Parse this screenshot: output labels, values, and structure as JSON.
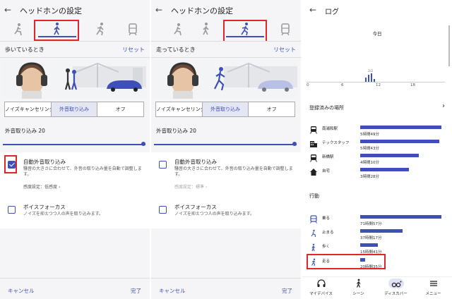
{
  "panel1": {
    "title": "ヘッドホンの設定",
    "section_label": "歩いているとき",
    "reset": "リセット",
    "modes": [
      "ノイズキャンセリング",
      "外音取り込み",
      "オフ"
    ],
    "selected_mode_index": 1,
    "ambient_label": "外音取り込み 20",
    "ambient_slider_fraction": 1.0,
    "auto_ambient_title": "自動外音取り込み",
    "auto_ambient_desc": "騒音の大きさに合わせて、外音の取り込み量を自動で調整します。",
    "auto_ambient_checked": true,
    "sensitivity": "感度設定：低感度",
    "voice_focus_title": "ボイスフォーカス",
    "voice_focus_desc": "ノイズを抑えつつ人の声を取り込みます。",
    "voice_focus_checked": false,
    "cancel": "キャンセル",
    "done": "完了"
  },
  "panel2": {
    "title": "ヘッドホンの設定",
    "section_label": "走っているとき",
    "reset": "リセット",
    "modes": [
      "ノイズキャンセリング",
      "外音取り込み",
      "オフ"
    ],
    "selected_mode_index": 1,
    "ambient_label": "外音取り込み 20",
    "ambient_slider_fraction": 1.0,
    "auto_ambient_title": "自動外音取り込み",
    "auto_ambient_desc": "騒音の大きさに合わせて、外音の取り込み量を自動で調整します。",
    "auto_ambient_checked": false,
    "sensitivity": "感度設定：標準",
    "voice_focus_title": "ボイスフォーカス",
    "voice_focus_desc": "ノイズを抑えつつ人の声を取り込みます。",
    "voice_focus_checked": false,
    "cancel": "キャンセル",
    "done": "完了"
  },
  "panel3": {
    "title": "ログ",
    "today": "今日",
    "histogram_peak_label": "2/2",
    "hour_ticks": [
      "0",
      "6",
      "12",
      "18"
    ],
    "places_title": "登録済みの場所",
    "places": [
      {
        "name": "南浦和駅",
        "time": "5時間49分",
        "fraction": 1.0,
        "icon": "train-icon"
      },
      {
        "name": "テックスタッフ",
        "time": "5時間43分",
        "fraction": 0.97,
        "icon": "building-icon"
      },
      {
        "name": "新橋駅",
        "time": "4時間10分",
        "fraction": 0.72,
        "icon": "train-icon"
      },
      {
        "name": "自宅",
        "time": "3時間28分",
        "fraction": 0.6,
        "icon": "home-icon"
      }
    ],
    "activity_title": "行動",
    "activities": [
      {
        "name": "乗る",
        "time": "71時間57分",
        "fraction": 1.0,
        "icon": "train-icon"
      },
      {
        "name": "止まる",
        "time": "37時間17分",
        "fraction": 0.52,
        "icon": "sitting-icon"
      },
      {
        "name": "歩く",
        "time": "15時間41分",
        "fraction": 0.22,
        "icon": "walking-icon"
      },
      {
        "name": "走る",
        "time": "20時間35分",
        "fraction": 0.06,
        "icon": "running-icon"
      }
    ],
    "nav": [
      "マイデバイス",
      "シーン",
      "ディスカバー",
      "メニュー"
    ]
  },
  "colors": {
    "accent": "#3e4fb8",
    "highlight": "#e0262c"
  }
}
